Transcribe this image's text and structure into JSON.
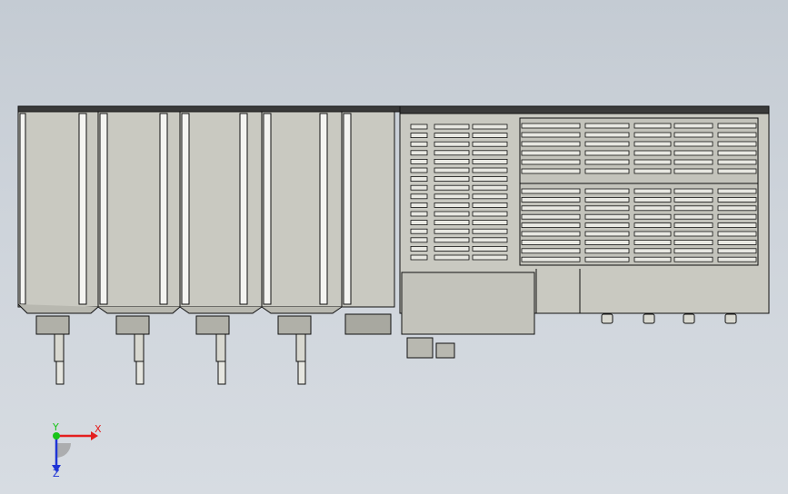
{
  "scene": {
    "background_top": "#c4cbd3",
    "background_bottom": "#d7dce2",
    "part_fill": "#c9c9c1",
    "edge_color": "#111111",
    "highlight_color": "#f4f4f1"
  },
  "triad": {
    "x_label": "X",
    "y_label": "Y",
    "z_label": "Z",
    "x_color": "#e41e1e",
    "y_color": "#18c418",
    "z_color": "#1f34d6"
  }
}
